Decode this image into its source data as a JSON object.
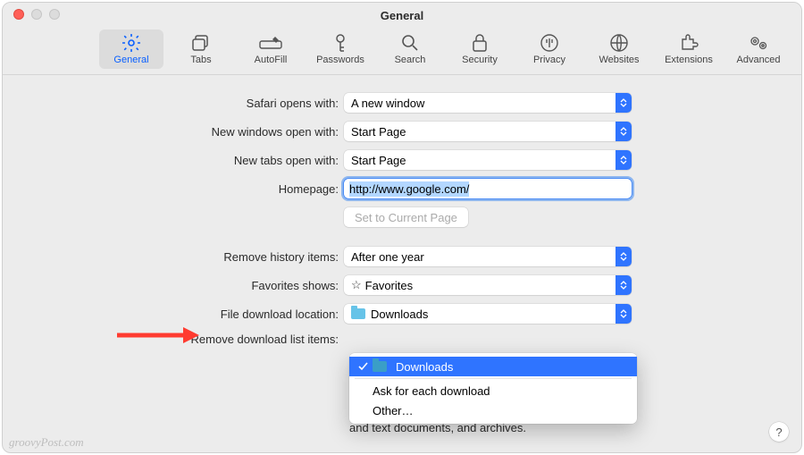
{
  "window": {
    "title": "General"
  },
  "traffic": {
    "close": "close",
    "minimize": "minimize",
    "zoom": "zoom"
  },
  "toolbar": {
    "items": [
      {
        "label": "General"
      },
      {
        "label": "Tabs"
      },
      {
        "label": "AutoFill"
      },
      {
        "label": "Passwords"
      },
      {
        "label": "Search"
      },
      {
        "label": "Security"
      },
      {
        "label": "Privacy"
      },
      {
        "label": "Websites"
      },
      {
        "label": "Extensions"
      },
      {
        "label": "Advanced"
      }
    ]
  },
  "form": {
    "safari_opens_label": "Safari opens with:",
    "safari_opens_value": "A new window",
    "new_windows_label": "New windows open with:",
    "new_windows_value": "Start Page",
    "new_tabs_label": "New tabs open with:",
    "new_tabs_value": "Start Page",
    "homepage_label": "Homepage:",
    "homepage_value": "http://www.google.com/",
    "set_current_label": "Set to Current Page",
    "remove_history_label": "Remove history items:",
    "remove_history_value": "After one year",
    "favorites_label": "Favorites shows:",
    "favorites_value": "Favorites",
    "download_loc_label": "File download location:",
    "download_loc_value": "Downloads",
    "remove_dl_label": "Remove download list items:"
  },
  "dropdown": {
    "selected": "Downloads",
    "ask": "Ask for each download",
    "other": "Other…"
  },
  "truncated_text": "and text documents, and archives.",
  "watermark": "groovyPost.com",
  "help": "?"
}
